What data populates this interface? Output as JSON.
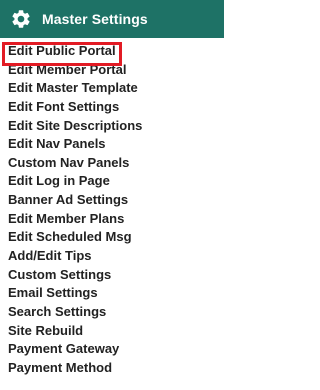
{
  "panel": {
    "title": "Master Settings",
    "icon": "gear-icon",
    "header_color": "#1e7266",
    "highlight_color": "#e21b24"
  },
  "menu": {
    "items": [
      {
        "label": "Edit Public Portal",
        "highlighted": true
      },
      {
        "label": "Edit Member Portal"
      },
      {
        "label": "Edit Master Template"
      },
      {
        "label": "Edit Font Settings"
      },
      {
        "label": "Edit Site Descriptions"
      },
      {
        "label": "Edit Nav Panels"
      },
      {
        "label": "Custom Nav Panels"
      },
      {
        "label": "Edit Log in Page"
      },
      {
        "label": "Banner Ad Settings"
      },
      {
        "label": "Edit Member Plans"
      },
      {
        "label": "Edit Scheduled Msg"
      },
      {
        "label": "Add/Edit Tips"
      },
      {
        "label": "Custom Settings"
      },
      {
        "label": "Email Settings"
      },
      {
        "label": "Search Settings"
      },
      {
        "label": "Site Rebuild"
      },
      {
        "label": "Payment Gateway"
      },
      {
        "label": "Payment Method"
      }
    ]
  }
}
